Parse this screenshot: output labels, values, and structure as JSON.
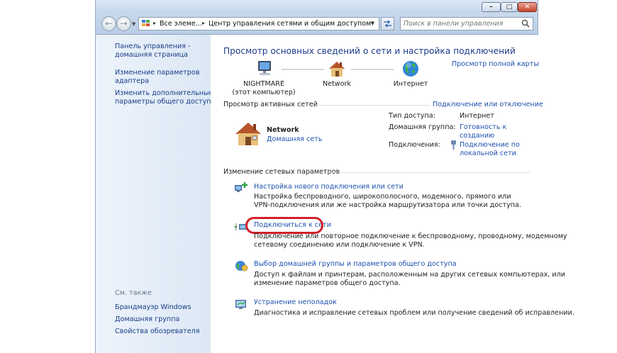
{
  "window": {
    "minimize_glyph": "–",
    "maximize_glyph": "□",
    "close_glyph": "✕"
  },
  "nav": {
    "back_glyph": "←",
    "forward_glyph": "→",
    "breadcrumb": [
      "Все элеме...",
      "Центр управления сетями и общим доступом"
    ],
    "search_placeholder": "Поиск в панели управления"
  },
  "sidebar": {
    "home_link": "Панель управления -\nдомашняя страница",
    "adapter_link": "Изменение параметров\nадаптера",
    "sharing_link": "Изменить дополнительные\nпараметры общего доступа",
    "see_also_label": "См. также",
    "see_also": [
      "Брандмауэр Windows",
      "Домашняя группа",
      "Свойства обозревателя"
    ]
  },
  "main": {
    "title": "Просмотр основных сведений о сети и настройка подключений",
    "full_map_link": "Просмотр полной карты",
    "map": {
      "computer_name": "NIGHTMARE",
      "computer_sub": "(этот компьютер)",
      "network_label": "Network",
      "internet_label": "Интернет"
    },
    "active_networks_label": "Просмотр активных сетей",
    "connect_disconnect_link": "Подключение или отключение",
    "active_network": {
      "name": "Network",
      "type_link": "Домашняя сеть",
      "access_type_label": "Тип доступа:",
      "access_type_value": "Интернет",
      "homegroup_label": "Домашняя группа:",
      "homegroup_value": "Готовность к\nсозданию",
      "connections_label": "Подключения:",
      "connections_value": "Подключение по\nлокальной сети"
    },
    "change_settings_label": "Изменение сетевых параметров",
    "tasks": [
      {
        "link": "Настройка нового подключения или сети",
        "desc": "Настройка беспроводного, широкополосного, модемного, прямого или\nVPN-подключения или же настройка маршрутизатора или точки доступа."
      },
      {
        "link": "Подключиться к сети",
        "desc": "Подключение или повторное подключение к беспроводному, проводному, модемному\nсетевому соединению или подключение к VPN."
      },
      {
        "link": "Выбор домашней группы и параметров общего доступа",
        "desc": "Доступ к файлам и принтерам, расположенным на других сетевых компьютерах, или\nизменение параметров общего доступа."
      },
      {
        "link": "Устранение неполадок",
        "desc": "Диагностика и исправление сетевых проблем или получение сведений об исправлении."
      }
    ]
  },
  "colors": {
    "link": "#1c4fae",
    "title": "#1e3b8a",
    "highlight": "#d11f2a"
  }
}
